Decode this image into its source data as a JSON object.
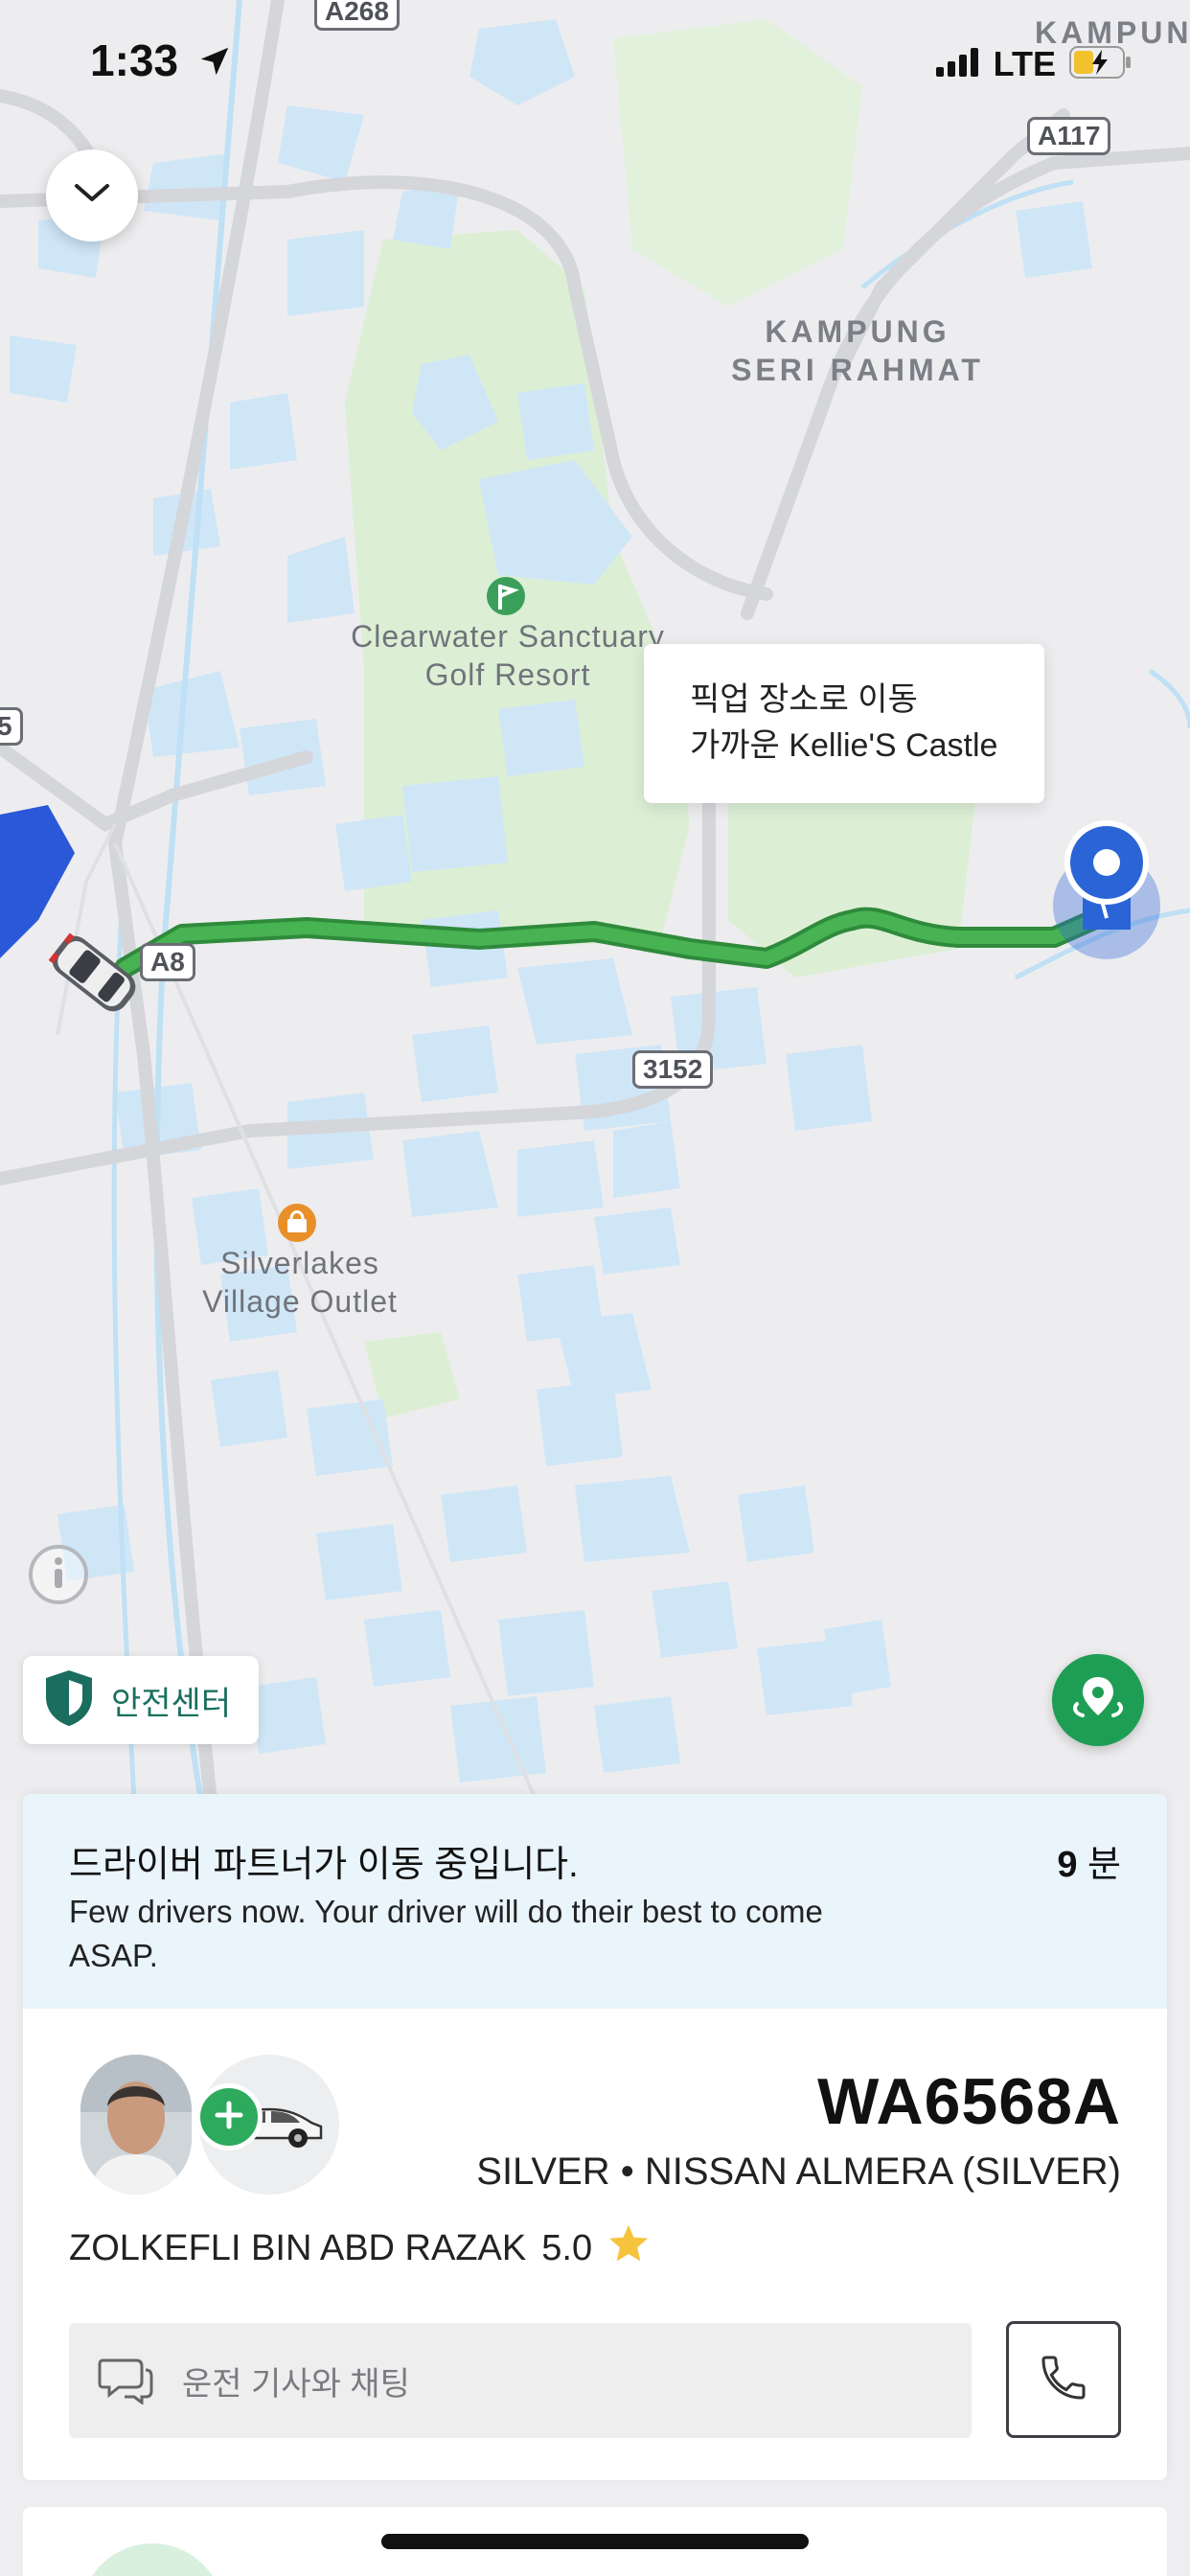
{
  "status_bar": {
    "time": "1:33",
    "network": "LTE",
    "location_icon": "location-arrow-icon",
    "signal_icon": "signal-bars-icon",
    "battery_icon": "battery-charging-icon"
  },
  "map": {
    "labels": {
      "kampung_seri_rahmat_1": "KAMPUNG",
      "kampung_seri_rahmat_2": "SERI RAHMAT",
      "golf_1": "Clearwater Sanctuary",
      "golf_2": "Golf Resort",
      "outlet_1": "Silverlakes",
      "outlet_2": "Village Outlet",
      "kampung_top": "KAMPUN"
    },
    "road_shields": {
      "a268": "A268",
      "a117": "A117",
      "a8": "A8",
      "r3152": "3152",
      "left_5": "5"
    },
    "pickup_tooltip": {
      "line1": "픽업 장소로 이동",
      "line2": "가까운 Kellie'S Castle"
    },
    "colors": {
      "route": "#3aa34a",
      "water": "#cfe6f7",
      "park": "#ddefd6",
      "pin": "#2a64d6"
    }
  },
  "controls": {
    "collapse_icon": "chevron-down-icon",
    "info_icon": "info-icon",
    "safety_center_label": "안전센터",
    "locate_icon": "location-pin-icon"
  },
  "trip": {
    "status_title": "드라이버 파트너가 이동 중입니다.",
    "eta_value": "9",
    "eta_unit": "분",
    "status_message": "Few drivers now. Your driver will do their best to come ASAP."
  },
  "driver": {
    "plate": "WA6568A",
    "vehicle": "SILVER • NISSAN ALMERA (SILVER)",
    "name": "ZOLKEFLI BIN ABD RAZAK",
    "rating": "5.0",
    "chat_placeholder": "운전 기사와 채팅",
    "accent_color": "#2eaa5c"
  }
}
